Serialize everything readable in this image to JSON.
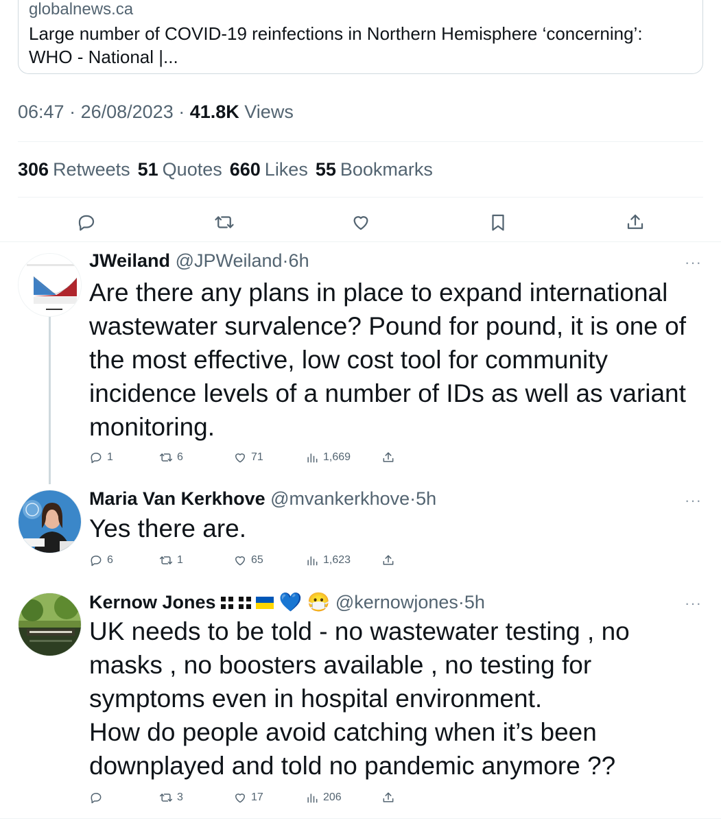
{
  "link_card": {
    "domain": "globalnews.ca",
    "title": "Large number of COVID-19 reinfections in Northern Hemisphere ‘concerning’: WHO - National |..."
  },
  "meta": {
    "time": "06:47",
    "sep1": " · ",
    "date": "26/08/2023",
    "sep2": " · ",
    "views_count": "41.8K",
    "views_label": " Views"
  },
  "stats": [
    {
      "num": "306",
      "label": "Retweets"
    },
    {
      "num": "51",
      "label": "Quotes"
    },
    {
      "num": "660",
      "label": "Likes"
    },
    {
      "num": "55",
      "label": "Bookmarks"
    }
  ],
  "actions": [
    "reply-icon",
    "retweet-icon",
    "like-icon",
    "bookmark-icon",
    "share-icon"
  ],
  "replies": [
    {
      "name": "JWeiland",
      "handle": "@JPWeiland",
      "dot": "·",
      "time": "6h",
      "more": "···",
      "text": "Are there any plans in place to expand international wastewater survalence?  Pound for pound, it is one of the most effective, low cost tool for community incidence levels of a number of IDs as well as variant monitoring.",
      "replies": "1",
      "retweets": "6",
      "likes": "71",
      "views": "1,669"
    },
    {
      "name": "Maria Van Kerkhove",
      "handle": "@mvankerkhove",
      "dot": "·",
      "time": "5h",
      "more": "···",
      "text": "Yes there are.",
      "replies": "6",
      "retweets": "1",
      "likes": "65",
      "views": "1,623"
    },
    {
      "name": "Kernow Jones",
      "handle": "@kernowjones",
      "dot": "·",
      "time": "5h",
      "more": "···",
      "emoji": "💙 😷",
      "text": "UK needs to be told - no wastewater testing , no masks , no boosters available , no testing for symptoms even in hospital environment.\nHow do people avoid catching when it’s been downplayed and told no pandemic anymore ??",
      "replies": "",
      "retweets": "3",
      "likes": "17",
      "views": "206"
    }
  ],
  "colors": {
    "text": "#0f1419",
    "secondary": "#536471",
    "border": "#eff3f4",
    "accent": "#1d9bf0"
  }
}
